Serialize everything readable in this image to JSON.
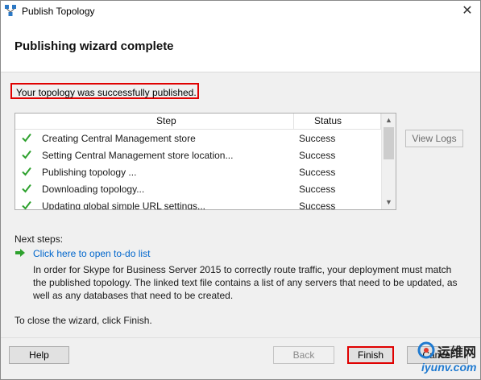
{
  "window": {
    "title": "Publish Topology",
    "close_glyph": "✕"
  },
  "header": {
    "page_title": "Publishing wizard complete"
  },
  "status_message": "Your topology was successfully published.",
  "log_table": {
    "columns": {
      "step": "Step",
      "status": "Status"
    },
    "rows": [
      {
        "step": "Creating Central Management store",
        "status": "Success"
      },
      {
        "step": "Setting Central Management store location...",
        "status": "Success"
      },
      {
        "step": "Publishing topology ...",
        "status": "Success"
      },
      {
        "step": "Downloading topology...",
        "status": "Success"
      },
      {
        "step": "Updating global simple URL settings...",
        "status": "Success"
      }
    ]
  },
  "buttons": {
    "view_logs": "View Logs",
    "help": "Help",
    "back": "Back",
    "finish": "Finish",
    "cancel": "Cancel"
  },
  "next_steps": {
    "label": "Next steps:",
    "todo_link": "Click here to open to-do list",
    "info": "In order for Skype for Business Server 2015 to correctly route traffic, your deployment must match the published topology. The linked text file contains a list of any servers that need to be updated, as well as any databases that need to be created."
  },
  "close_instruction": "To close the wizard, click Finish.",
  "watermark": {
    "cn": "运维网",
    "url": "iyunv.com"
  },
  "colors": {
    "highlight": "#e00000",
    "check": "#2ea12e",
    "link": "#0066cc"
  },
  "icons": {
    "app": "topology-icon",
    "check": "check-icon",
    "arrow": "green-arrow-icon"
  }
}
